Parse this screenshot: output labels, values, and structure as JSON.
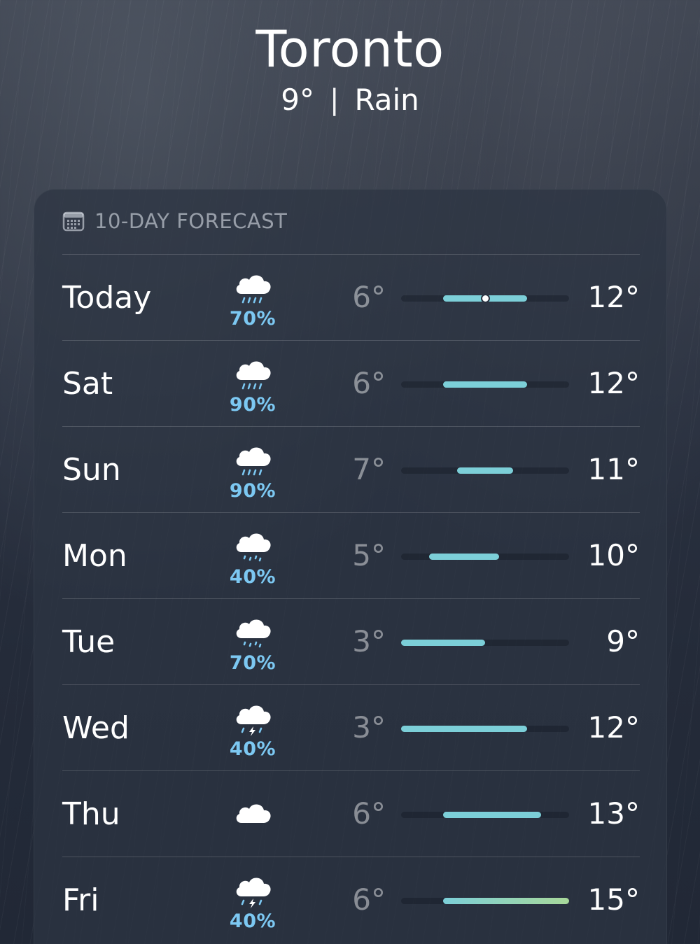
{
  "location": {
    "city": "Toronto",
    "temperature": "9°",
    "separator": "|",
    "condition": "Rain"
  },
  "forecast": {
    "title": "10-DAY FORECAST",
    "icon": "calendar-icon",
    "range_min": 3,
    "range_max": 15,
    "current_temp": 9,
    "days": [
      {
        "day": "Today",
        "icon": "cloud-rain-icon",
        "precip": "70%",
        "low": "6°",
        "high": "12°",
        "low_val": 6,
        "high_val": 12,
        "current": true
      },
      {
        "day": "Sat",
        "icon": "cloud-rain-icon",
        "precip": "90%",
        "low": "6°",
        "high": "12°",
        "low_val": 6,
        "high_val": 12
      },
      {
        "day": "Sun",
        "icon": "cloud-rain-icon",
        "precip": "90%",
        "low": "7°",
        "high": "11°",
        "low_val": 7,
        "high_val": 11
      },
      {
        "day": "Mon",
        "icon": "cloud-drizzle-icon",
        "precip": "40%",
        "low": "5°",
        "high": "10°",
        "low_val": 5,
        "high_val": 10
      },
      {
        "day": "Tue",
        "icon": "cloud-drizzle-icon",
        "precip": "70%",
        "low": "3°",
        "high": "9°",
        "low_val": 3,
        "high_val": 9
      },
      {
        "day": "Wed",
        "icon": "cloud-bolt-rain-icon",
        "precip": "40%",
        "low": "3°",
        "high": "12°",
        "low_val": 3,
        "high_val": 12
      },
      {
        "day": "Thu",
        "icon": "cloud-icon",
        "precip": "",
        "low": "6°",
        "high": "13°",
        "low_val": 6,
        "high_val": 13
      },
      {
        "day": "Fri",
        "icon": "cloud-bolt-rain-icon",
        "precip": "40%",
        "low": "6°",
        "high": "15°",
        "low_val": 6,
        "high_val": 15
      }
    ]
  },
  "colors": {
    "precip_text": "#7cc8f2",
    "bar_cool": "#7ccfd8",
    "bar_warm": "#a8d89a"
  }
}
